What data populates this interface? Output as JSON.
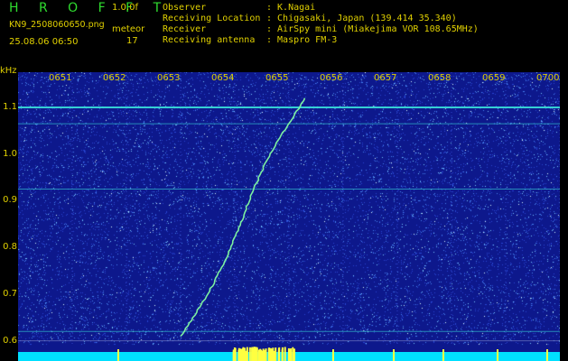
{
  "header": {
    "brand": "H R O F F T",
    "version": "1.0.0f",
    "filename": "KN9_2508060650.png",
    "mode": "meteor",
    "count": "17",
    "datetime": "25.08.06 06:50",
    "info": [
      {
        "label": "Observer",
        "value": ": K.Nagai"
      },
      {
        "label": "Receiving Location",
        "value": ": Chigasaki, Japan (139.414 35.340)"
      },
      {
        "label": "Receiver",
        "value": ": AirSpy mini (Miakejima VOR 108.65MHz)"
      },
      {
        "label": "Receiving antenna",
        "value": ": Maspro FM-3"
      }
    ]
  },
  "chart_data": {
    "type": "heatmap",
    "ylabel": "kHz",
    "y_ticks": [
      "1.1",
      "1.0",
      "0.9",
      "0.8",
      "0.7",
      "0.6"
    ],
    "x_ticks": [
      "0651",
      "0652",
      "0653",
      "0654",
      "0655",
      "0656",
      "0657",
      "0658",
      "0659",
      "0700"
    ],
    "ylim": [
      0.58,
      1.16
    ],
    "xlim": [
      "06:50",
      "07:00"
    ],
    "carrier_lines_khz": [
      1.1,
      1.065,
      0.925,
      0.62
    ],
    "meteor_trace": {
      "start": {
        "time": "06:53",
        "khz": 0.61
      },
      "end": {
        "time": "06:55.3",
        "khz": 1.12
      }
    }
  },
  "colors": {
    "background": "#0d188c",
    "text": "#e0d000",
    "brand": "#2fdc2f",
    "trace": "#7cf0a0",
    "carrier": "#38d8d8",
    "power_bar": "#00e0ff",
    "power_peak": "#ffff40"
  }
}
